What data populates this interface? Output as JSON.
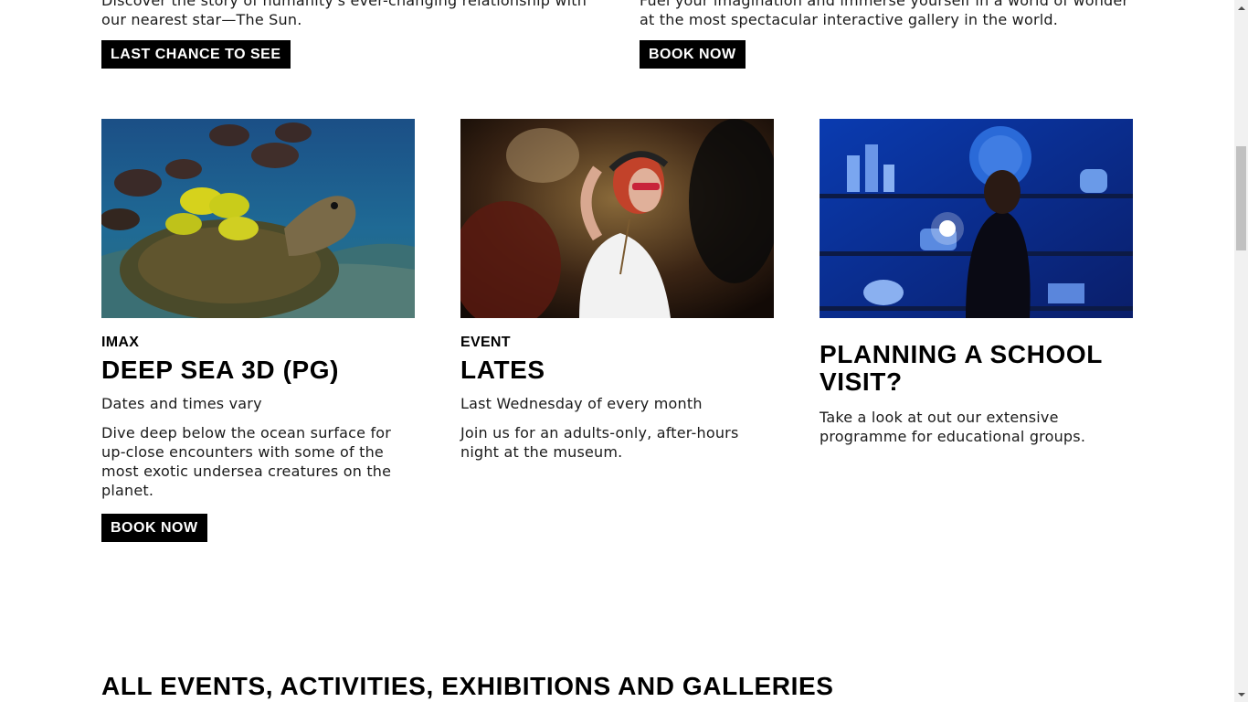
{
  "top_row": [
    {
      "description": "Discover the story of humanity's ever-changing relationship with our nearest star—The Sun.",
      "button_label": "LAST CHANCE TO SEE"
    },
    {
      "description": "Fuel your imagination and immerse yourself in a world of wonder at the most spectacular interactive gallery in the world.",
      "button_label": "BOOK NOW"
    }
  ],
  "cards": [
    {
      "kicker": "IMAX",
      "title": "DEEP SEA 3D (PG)",
      "meta": "Dates and times vary",
      "description": "Dive deep below the ocean surface for up-close encounters with some of the most exotic undersea creatures on the planet.",
      "button_label": "BOOK NOW"
    },
    {
      "kicker": "EVENT",
      "title": "LATES",
      "meta": "Last Wednesday of every month",
      "description": "Join us for an adults-only, after-hours night at the museum."
    },
    {
      "title": "PLANNING A SCHOOL VISIT?",
      "description": "Take a look at out our extensive programme for educational groups."
    }
  ],
  "section_title": "ALL EVENTS, ACTIVITIES, EXHIBITIONS AND GALLERIES",
  "colors": {
    "button_bg": "#000000",
    "button_text": "#ffffff",
    "text": "#1a1a1a",
    "ocean": "#1f5a86",
    "gallery_blue": "#0a3bb0"
  }
}
